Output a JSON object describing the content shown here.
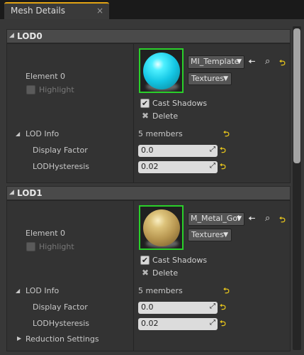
{
  "tab": {
    "title": "Mesh Details",
    "close": "×"
  },
  "icons": {
    "collapse": "◢",
    "caret": "▼",
    "use": "🠄",
    "browse": "⌕",
    "reset": "⮌",
    "check": "✔",
    "delete": "✖",
    "drag": "⤢"
  },
  "lods": [
    {
      "title": "LOD0",
      "element_label": "Element 0",
      "highlight_label": "Highlight",
      "material_name": "MI_Template",
      "textures_label": "Textures",
      "cast_shadows_label": "Cast Shadows",
      "delete_label": "Delete",
      "lod_info_label": "LOD Info",
      "lod_info_value": "5 members",
      "display_factor_label": "Display Factor",
      "display_factor_value": "0.0",
      "hysteresis_label": "LODHysteresis",
      "hysteresis_value": "0.02"
    },
    {
      "title": "LOD1",
      "element_label": "Element 0",
      "highlight_label": "Highlight",
      "material_name": "M_Metal_Gol",
      "textures_label": "Textures",
      "cast_shadows_label": "Cast Shadows",
      "delete_label": "Delete",
      "lod_info_label": "LOD Info",
      "lod_info_value": "5 members",
      "display_factor_label": "Display Factor",
      "display_factor_value": "0.0",
      "hysteresis_label": "LODHysteresis",
      "hysteresis_value": "0.02",
      "reduction_label": "Reduction Settings"
    }
  ],
  "colors": {
    "accent": "#e2a314",
    "thumb_border": "#2ad02a",
    "reset": "#e7c51c"
  }
}
